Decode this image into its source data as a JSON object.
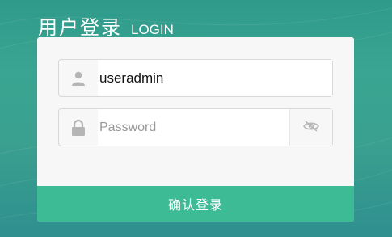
{
  "header": {
    "title_cn": "用户登录",
    "title_en": "LOGIN"
  },
  "form": {
    "username": {
      "value": "useradmin",
      "icon": "user-icon"
    },
    "password": {
      "placeholder": "Password",
      "icon": "lock-icon",
      "toggle_icon": "eye-slash-icon"
    },
    "submit_label": "确认登录"
  },
  "colors": {
    "background": "#3aa592",
    "card": "#f7f7f7",
    "submit": "#3dbb94",
    "icon": "#b5b5b5"
  }
}
